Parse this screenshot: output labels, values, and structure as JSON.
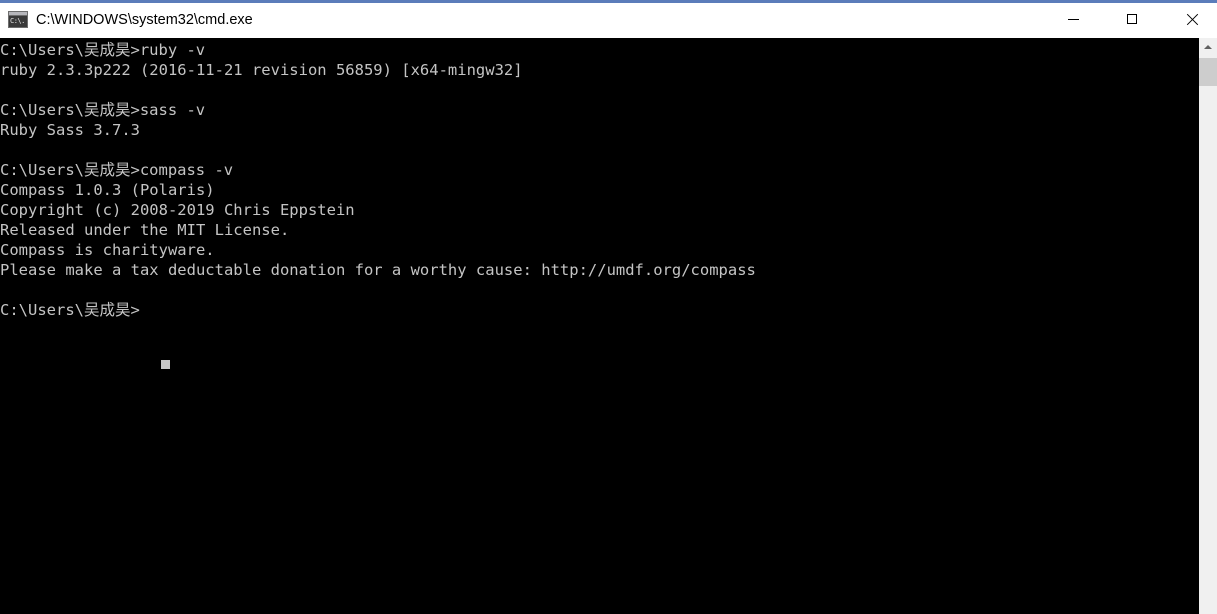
{
  "window": {
    "title": "C:\\WINDOWS\\system32\\cmd.exe",
    "icon_label": "C:\\.",
    "accent_color": "#5b7cba",
    "titlebar_background": "#ffffff",
    "console_background": "#000000",
    "console_foreground": "#c4c4c4"
  },
  "controls": {
    "minimize_label": "—",
    "maximize_label": "□",
    "close_label": "×",
    "minimize_name": "Minimize",
    "maximize_name": "Maximize",
    "close_name": "Close"
  },
  "scrollbar": {
    "up_arrow": "˄",
    "thumb_position_percent": 3
  },
  "console": {
    "prompt": "C:\\Users\\吴成昊>",
    "cursor_visible": true,
    "lines": [
      "C:\\Users\\吴成昊>ruby -v",
      "ruby 2.3.3p222 (2016-11-21 revision 56859) [x64-mingw32]",
      "",
      "C:\\Users\\吴成昊>sass -v",
      "Ruby Sass 3.7.3",
      "",
      "C:\\Users\\吴成昊>compass -v",
      "Compass 1.0.3 (Polaris)",
      "Copyright (c) 2008-2019 Chris Eppstein",
      "Released under the MIT License.",
      "Compass is charityware.",
      "Please make a tax deductable donation for a worthy cause: http://umdf.org/compass",
      "",
      "C:\\Users\\吴成昊>"
    ]
  }
}
